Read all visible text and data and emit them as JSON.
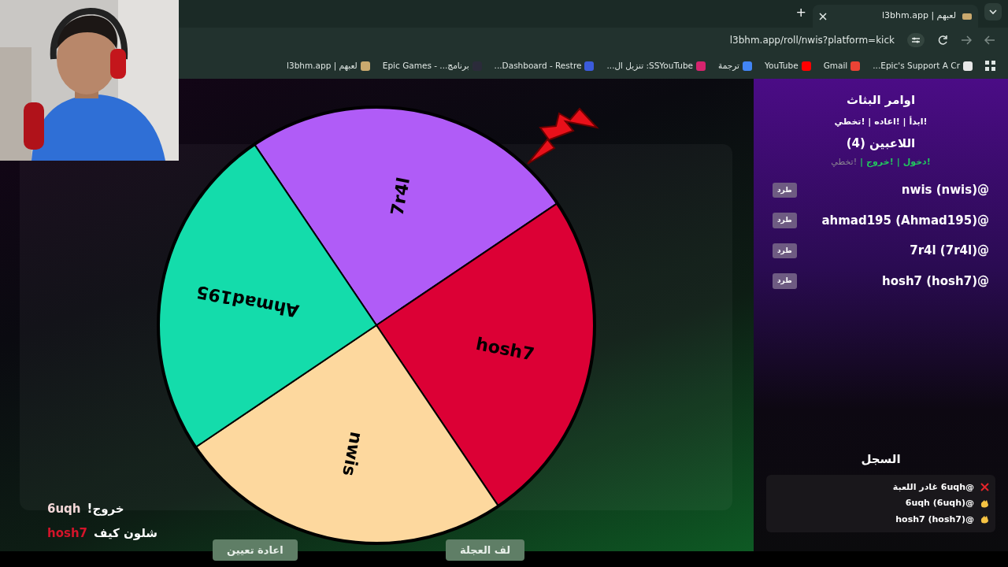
{
  "browser": {
    "tab": {
      "title": "لعبهم | l3bhm.app"
    },
    "new_tab": "+",
    "address": "l3bhm.app/roll/nwis?platform=kick",
    "bookmarks": [
      {
        "label": "Epic's Support A Cr...",
        "color": "#e8e8e8"
      },
      {
        "label": "Gmail",
        "color": "#ea4335"
      },
      {
        "label": "YouTube",
        "color": "#ff0000"
      },
      {
        "label": "ترجمة",
        "color": "#4285f4"
      },
      {
        "label": "SSYouTube: تنزيل ال...",
        "color": "#d6246e"
      },
      {
        "label": "Dashboard - Restre...",
        "color": "#3b5bdb"
      },
      {
        "label": "برنامج... - Epic Games",
        "color": "#2b2b3a"
      },
      {
        "label": "لعبهم | l3bhm.app",
        "color": "#c9a96e"
      }
    ]
  },
  "wheel": {
    "segments": [
      {
        "label": "7r4l",
        "color": "#b05cf7"
      },
      {
        "label": "hosh7",
        "color": "#dc0035"
      },
      {
        "label": "nwis",
        "color": "#fdd89e"
      },
      {
        "label": "Ahmad195",
        "color": "#14dcab"
      }
    ]
  },
  "chat": [
    {
      "user": "6uqh",
      "message": "خروج!",
      "color": "#f2d7d7"
    },
    {
      "user": "hosh7",
      "message": "شلون كيف",
      "color": "#d4142a"
    }
  ],
  "buttons": [
    {
      "label": "لف العجلة"
    },
    {
      "label": "اعادة تعيين"
    }
  ],
  "sidebar": {
    "title": "اوامر البثاث",
    "streamer_commands": "!ابدأ | !اعاده | !تخطي",
    "players_title": "اللاعبين (4)",
    "player_commands": [
      {
        "label": "!دخول",
        "enabled": true
      },
      {
        "label": "|",
        "enabled": true
      },
      {
        "label": "!خروج",
        "enabled": true
      },
      {
        "label": "|",
        "enabled": true
      },
      {
        "label": "!تخطي",
        "enabled": false
      }
    ],
    "players": [
      {
        "name": "@nwis (nwis)",
        "action": "طرد"
      },
      {
        "name": "@ahmad195 (Ahmad195)",
        "action": "طرد"
      },
      {
        "name": "@7r4l (7r4l)",
        "action": "طرد"
      },
      {
        "name": "@hosh7 (hosh7)",
        "action": "طرد"
      }
    ],
    "log_title": "السجل",
    "log": [
      {
        "kind": "left",
        "text": "@6uqh غادر اللعبة"
      },
      {
        "kind": "joined",
        "text": "@6uqh (6uqh)"
      },
      {
        "kind": "joined",
        "text": "@hosh7 (hosh7)"
      }
    ]
  }
}
